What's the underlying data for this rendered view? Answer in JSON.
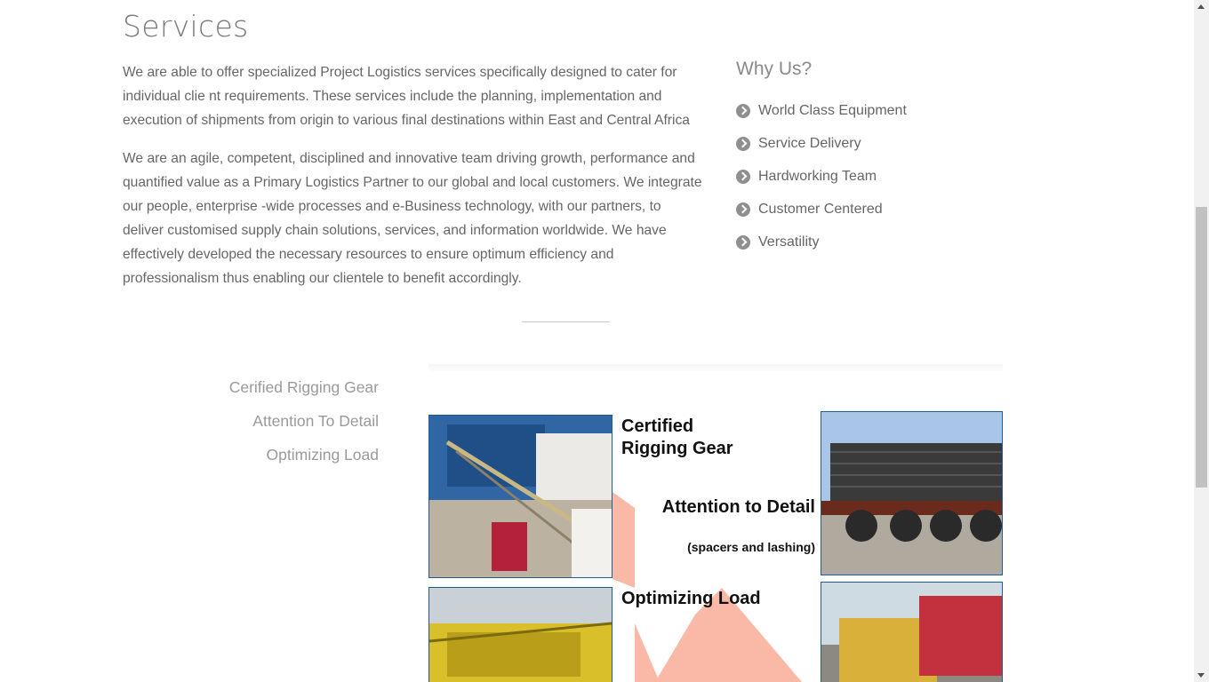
{
  "section": {
    "title": "Services",
    "paragraphs": [
      "We are able to offer specialized Project Logistics services specifically designed to cater for individual clie nt requirements. These services include the planning, implementation and execution of shipments from origin to various final destinations within East and Central Africa",
      "We are an agile, competent, disciplined and innovative team driving growth, performance and quantified value as a Primary Logistics Partner to our global and local customers. We integrate our people, enterprise -wide processes and e-Business technology, with our partners, to deliver customised supply chain solutions, services, and information worldwide. We have effectively developed the necessary resources to ensure optimum efficiency and professionalism thus enabling our clientele to benefit accordingly."
    ]
  },
  "why_us": {
    "title": "Why Us?",
    "items": [
      {
        "label": "World Class Equipment",
        "icon": "chevron-circle-right-icon"
      },
      {
        "label": "Service Delivery",
        "icon": "chevron-circle-right-icon"
      },
      {
        "label": "Hardworking Team",
        "icon": "chevron-circle-right-icon"
      },
      {
        "label": "Customer Centered",
        "icon": "chevron-circle-right-icon"
      },
      {
        "label": "Versatility",
        "icon": "chevron-circle-right-icon"
      }
    ]
  },
  "tabs": [
    "Cerified Rigging Gear",
    "Attention To Detail",
    "Optimizing Load"
  ],
  "graphic": {
    "label1": "Certified Rigging Gear",
    "label2": "Attention to Detail",
    "label2_sub": "(spacers and lashing)",
    "label3": "Optimizing Load",
    "accent": "#f9b9a6"
  },
  "colors": {
    "text": "#666666",
    "heading": "#7a7a7a",
    "photo_border": "#1d5c94"
  }
}
